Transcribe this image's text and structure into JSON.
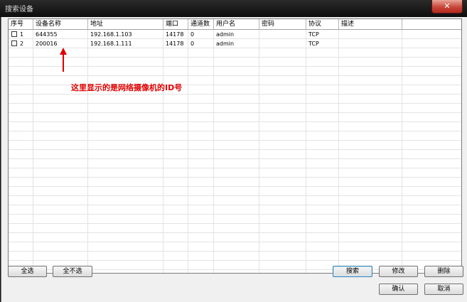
{
  "window": {
    "title": "搜索设备",
    "close_glyph": "✕"
  },
  "table": {
    "columns": [
      "序号",
      "设备名称",
      "地址",
      "端口",
      "通道数",
      "用户名",
      "密码",
      "协议",
      "描述"
    ],
    "rows": [
      {
        "index": "1",
        "name": "644355",
        "address": "192.168.1.103",
        "port": "14178",
        "channels": "0",
        "user": "admin",
        "password": "",
        "protocol": "TCP",
        "description": "",
        "checked": false
      },
      {
        "index": "2",
        "name": "200016",
        "address": "192.168.1.111",
        "port": "14178",
        "channels": "0",
        "user": "admin",
        "password": "",
        "protocol": "TCP",
        "description": "",
        "checked": false
      }
    ]
  },
  "annotation": {
    "text": "这里显示的是网络摄像机的ID号",
    "color": "#e00000"
  },
  "buttons": {
    "select_all": "全选",
    "select_none": "全不选",
    "search": "搜索",
    "modify": "修改",
    "delete": "删除",
    "confirm": "确认",
    "cancel": "取消"
  }
}
